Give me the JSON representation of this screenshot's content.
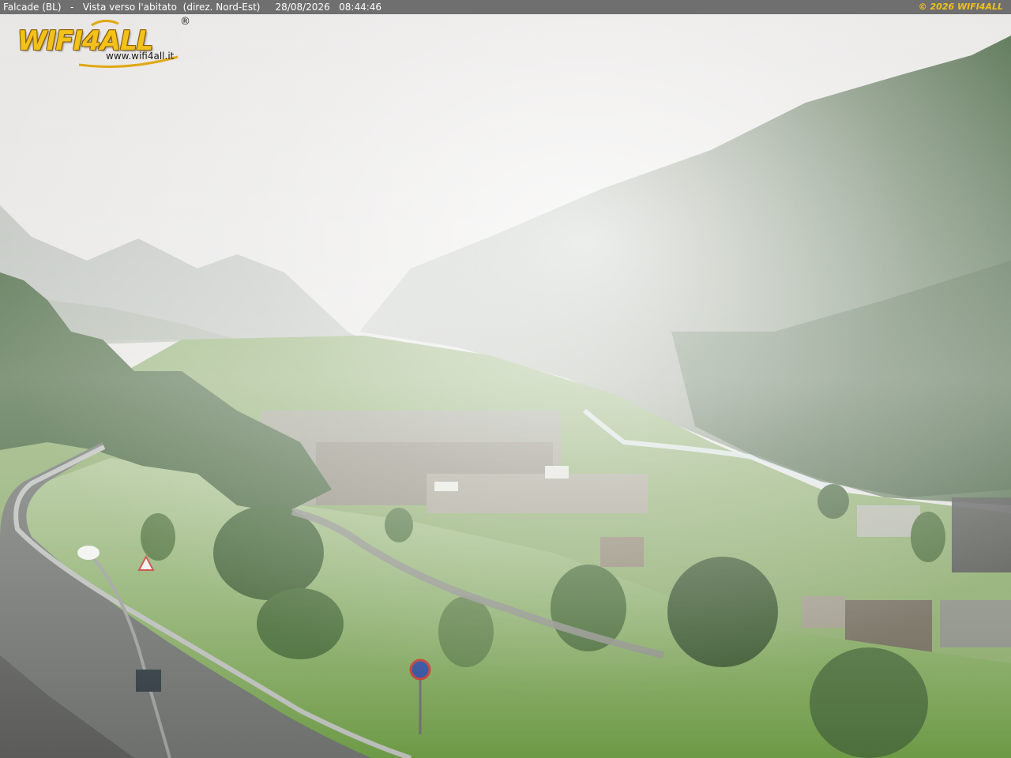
{
  "camera": {
    "caption": "Falcade (BL)   -   Vista verso l'abitato  (direz. Nord-Est)     28/08/2026   08:44:46",
    "copyright": "© 2026 WIFI4ALL"
  },
  "logo": {
    "wordmark": "WIFI4ALL",
    "registered": "®",
    "url": "www.wifi4all.it"
  },
  "colors": {
    "caption_bar": "#6f6f6f",
    "brand_yellow": "#f2c21a",
    "sky_haze": "#e4e2e1",
    "meadow": "#6f9a45",
    "forest": "#3e5a38"
  }
}
